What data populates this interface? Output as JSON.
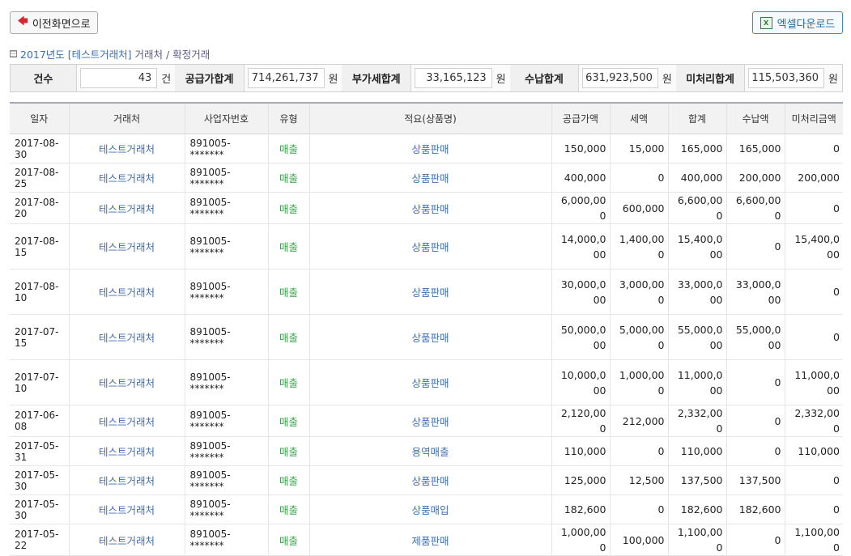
{
  "toolbar": {
    "back_label": "이전화면으로",
    "excel_label": "엑셀다운로드",
    "excel_icon": "excel-icon"
  },
  "section": {
    "year_part": "2017년도 [테스트거래처]",
    "rest_part": "거래처 / 확정거래"
  },
  "summary": {
    "count_label": "건수",
    "count_value": "43",
    "count_unit": "건",
    "supply_label": "공급가합계",
    "supply_value": "714,261,737",
    "supply_unit": "원",
    "vat_label": "부가세합계",
    "vat_value": "33,165,123",
    "vat_unit": "원",
    "paid_label": "수납합계",
    "paid_value": "631,923,500",
    "paid_unit": "원",
    "unpaid_label": "미처리합계",
    "unpaid_value": "115,503,360",
    "unpaid_unit": "원"
  },
  "table": {
    "headers": [
      "일자",
      "거래처",
      "사업자번호",
      "유형",
      "적요(상품명)",
      "공급가액",
      "세액",
      "합계",
      "수납액",
      "미처리금액"
    ],
    "rows": [
      {
        "date": "2017-08-30",
        "client": "테스트거래처",
        "biz": "891005-*******",
        "type": "매출",
        "desc": "상품판매",
        "supply": "150,000",
        "tax": "15,000",
        "total": "165,000",
        "paid": "165,000",
        "unpaid": "0"
      },
      {
        "date": "2017-08-25",
        "client": "테스트거래처",
        "biz": "891005-*******",
        "type": "매출",
        "desc": "상품판매",
        "supply": "400,000",
        "tax": "0",
        "total": "400,000",
        "paid": "200,000",
        "unpaid": "200,000"
      },
      {
        "date": "2017-08-20",
        "client": "테스트거래처",
        "biz": "891005-*******",
        "type": "매출",
        "desc": "상품판매",
        "supply": "6,000,000",
        "tax": "600,000",
        "total": "6,600,000",
        "paid": "6,600,000",
        "unpaid": "0"
      },
      {
        "date": "2017-08-15",
        "client": "테스트거래처",
        "biz": "891005-*******",
        "type": "매출",
        "desc": "상품판매",
        "supply": "14,000,000",
        "tax": "1,400,000",
        "total": "15,400,000",
        "paid": "0",
        "unpaid": "15,400,000"
      },
      {
        "date": "2017-08-10",
        "client": "테스트거래처",
        "biz": "891005-*******",
        "type": "매출",
        "desc": "상품판매",
        "supply": "30,000,000",
        "tax": "3,000,000",
        "total": "33,000,000",
        "paid": "33,000,000",
        "unpaid": "0"
      },
      {
        "date": "2017-07-15",
        "client": "테스트거래처",
        "biz": "891005-*******",
        "type": "매출",
        "desc": "상품판매",
        "supply": "50,000,000",
        "tax": "5,000,000",
        "total": "55,000,000",
        "paid": "55,000,000",
        "unpaid": "0"
      },
      {
        "date": "2017-07-10",
        "client": "테스트거래처",
        "biz": "891005-*******",
        "type": "매출",
        "desc": "상품판매",
        "supply": "10,000,000",
        "tax": "1,000,000",
        "total": "11,000,000",
        "paid": "0",
        "unpaid": "11,000,000"
      },
      {
        "date": "2017-06-08",
        "client": "테스트거래처",
        "biz": "891005-*******",
        "type": "매출",
        "desc": "상품판매",
        "supply": "2,120,000",
        "tax": "212,000",
        "total": "2,332,000",
        "paid": "0",
        "unpaid": "2,332,000"
      },
      {
        "date": "2017-05-31",
        "client": "테스트거래처",
        "biz": "891005-*******",
        "type": "매출",
        "desc": "용역매출",
        "supply": "110,000",
        "tax": "0",
        "total": "110,000",
        "paid": "0",
        "unpaid": "110,000"
      },
      {
        "date": "2017-05-30",
        "client": "테스트거래처",
        "biz": "891005-*******",
        "type": "매출",
        "desc": "상품판매",
        "supply": "125,000",
        "tax": "12,500",
        "total": "137,500",
        "paid": "137,500",
        "unpaid": "0"
      },
      {
        "date": "2017-05-30",
        "client": "테스트거래처",
        "biz": "891005-*******",
        "type": "매출",
        "desc": "상품매입",
        "supply": "182,600",
        "tax": "0",
        "total": "182,600",
        "paid": "182,600",
        "unpaid": "0"
      },
      {
        "date": "2017-05-22",
        "client": "테스트거래처",
        "biz": "891005-*******",
        "type": "매출",
        "desc": "제품판매",
        "supply": "1,000,000",
        "tax": "100,000",
        "total": "1,100,000",
        "paid": "0",
        "unpaid": "1,100,000"
      }
    ]
  }
}
